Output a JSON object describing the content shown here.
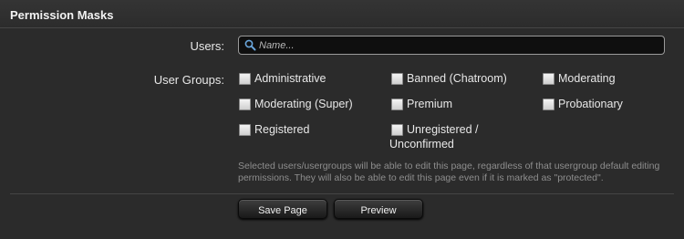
{
  "header": {
    "title": "Permission Masks"
  },
  "users": {
    "label": "Users:",
    "search": {
      "value": "",
      "placeholder": "Name...",
      "icon": "search-icon"
    }
  },
  "groups": {
    "label": "User Groups:",
    "items": [
      {
        "label": "Administrative",
        "checked": false
      },
      {
        "label": "Banned (Chatroom)",
        "checked": false
      },
      {
        "label": "Moderating",
        "checked": false
      },
      {
        "label": "Moderating (Super)",
        "checked": false
      },
      {
        "label": "Premium",
        "checked": false
      },
      {
        "label": "Probationary",
        "checked": false
      },
      {
        "label": "Registered",
        "checked": false
      },
      {
        "label": "Unregistered /",
        "label_line2": "Unconfirmed",
        "checked": false
      }
    ]
  },
  "help_text": "Selected users/usergroups will be able to edit this page, regardless of that usergroup default editing permissions. They will also be able to edit this page even if it is marked as \"protected\".",
  "buttons": {
    "save": "Save Page",
    "preview": "Preview"
  }
}
